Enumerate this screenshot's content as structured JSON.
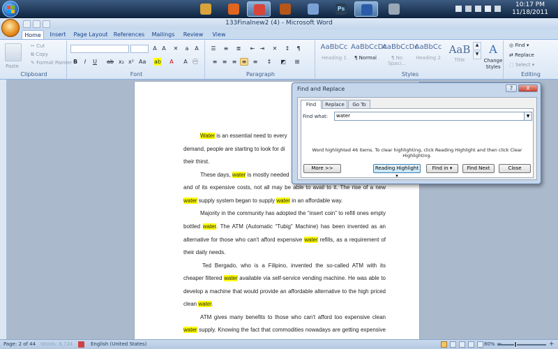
{
  "taskbar": {
    "clock_time": "10:17 PM",
    "clock_date": "11/18/2011",
    "apps": [
      {
        "name": "explorer",
        "color": "#d9a23b"
      },
      {
        "name": "firefox",
        "color": "#e0651f"
      },
      {
        "name": "chrome",
        "color": "#d8453a"
      },
      {
        "name": "app-4",
        "color": "#b5571b"
      },
      {
        "name": "app-5",
        "color": "#7aa0d6"
      },
      {
        "name": "photoshop",
        "color": "#2b3f55",
        "label": "Ps"
      },
      {
        "name": "word",
        "color": "#2a5ba8"
      },
      {
        "name": "app-8",
        "color": "#9aa8b6"
      }
    ]
  },
  "window": {
    "title": "133Finalnew2 (4) - Microsoft Word"
  },
  "ribbon": {
    "tabs": [
      "Home",
      "Insert",
      "Page Layout",
      "References",
      "Mailings",
      "Review",
      "View"
    ],
    "clipboard": {
      "paste": "Paste",
      "cut": "Cut",
      "copy": "Copy",
      "format_painter": "Format Painter",
      "label": "Clipboard"
    },
    "font": {
      "label": "Font"
    },
    "paragraph": {
      "label": "Paragraph"
    },
    "styles": {
      "label": "Styles",
      "items": [
        {
          "sample": "AaBbCc",
          "name": "Heading 1"
        },
        {
          "sample": "AaBbCcDc",
          "name": "¶ Normal"
        },
        {
          "sample": "AaBbCcDc",
          "name": "¶ No Spaci..."
        },
        {
          "sample": "AaBbCc",
          "name": "Heading 2"
        },
        {
          "sample": "AaB",
          "name": "Title"
        }
      ],
      "change_styles": "Change Styles"
    },
    "editing": {
      "find": "Find",
      "replace": "Replace",
      "select": "Select",
      "label": "Editing"
    }
  },
  "document": {
    "paragraphs": [
      [
        {
          "t": "Water",
          "h": true
        },
        {
          "t": " is an essential need to every"
        }
      ],
      [
        {
          "t": "demand, people are starting to look for di"
        }
      ],
      [
        {
          "t": "their thirst."
        }
      ],
      [
        {
          "t": "These days, "
        },
        {
          "t": "water",
          "h": true
        },
        {
          "t": " is mostly needed"
        }
      ],
      [
        {
          "t": "and of its expensive costs, not all may be able to avail to it. The rise of a new"
        }
      ],
      [
        {
          "t": "water",
          "h": true
        },
        {
          "t": " supply system began to supply "
        },
        {
          "t": "water",
          "h": true
        },
        {
          "t": " in an affordable way."
        }
      ],
      [
        {
          "t": "Majority in the community has adopted the “insert coin” to refill ones empty"
        }
      ],
      [
        {
          "t": "bottled "
        },
        {
          "t": "water",
          "h": true
        },
        {
          "t": ". The ATM (Automatic “Tubig” Machine) has been invented as an"
        }
      ],
      [
        {
          "t": "alternative for those who can't afford expensive "
        },
        {
          "t": "water",
          "h": true
        },
        {
          "t": " refills, as a requirement of"
        }
      ],
      [
        {
          "t": "their daily needs."
        }
      ],
      [
        {
          "t": "Ted Bergado, who is a Filipino, invented the so-called ATM with its"
        }
      ],
      [
        {
          "t": "cheaper filtered "
        },
        {
          "t": "water",
          "h": true
        },
        {
          "t": " available via self-service vending machine. He was able to"
        }
      ],
      [
        {
          "t": "develop a machine that would provide an affordable alternative to the high priced"
        }
      ],
      [
        {
          "t": "clean "
        },
        {
          "t": "water",
          "h": true
        },
        {
          "t": "."
        }
      ],
      [
        {
          "t": "ATM gives many benefits to those who can't afford too expensive clean"
        }
      ],
      [
        {
          "t": "water",
          "h": true
        },
        {
          "t": " supply. Knowing the fact that commodities nowadays are getting expensive"
        }
      ]
    ]
  },
  "dialog": {
    "title": "Find and Replace",
    "tabs": [
      "Find",
      "Replace",
      "Go To"
    ],
    "find_what_label": "Find what:",
    "find_what_value": "water",
    "message": "Word highlighted 46 items. To clear highlighting, click Reading Highlight and then click Clear Highlighting.",
    "buttons": {
      "more": "More >>",
      "reading_highlight": "Reading Highlight",
      "find_in": "Find in",
      "find_next": "Find Next",
      "close": "Close"
    },
    "help": "?",
    "close_glyph": "X"
  },
  "status": {
    "page": "Page: 2 of 44",
    "words": "Words: 8,724",
    "language": "English (United States)",
    "zoom": "80%",
    "zoom_level": 0.8
  }
}
